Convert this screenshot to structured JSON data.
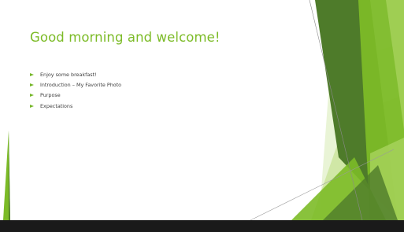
{
  "slide": {
    "title": "Good morning and welcome!",
    "bullets": [
      "Enjoy some breakfast!",
      "Introduction – My Favorite Photo",
      "Purpose",
      "Expectations"
    ]
  },
  "theme": {
    "accent": "#7cbb27",
    "text": "#404040",
    "background": "#ffffff",
    "decoration_colors": [
      "#4e7b2a",
      "#7cbb27",
      "#a6d25b",
      "#c9e39a",
      "#e2f0c8"
    ]
  },
  "icons": {
    "bullet": "green-triangle-bullet-icon"
  }
}
